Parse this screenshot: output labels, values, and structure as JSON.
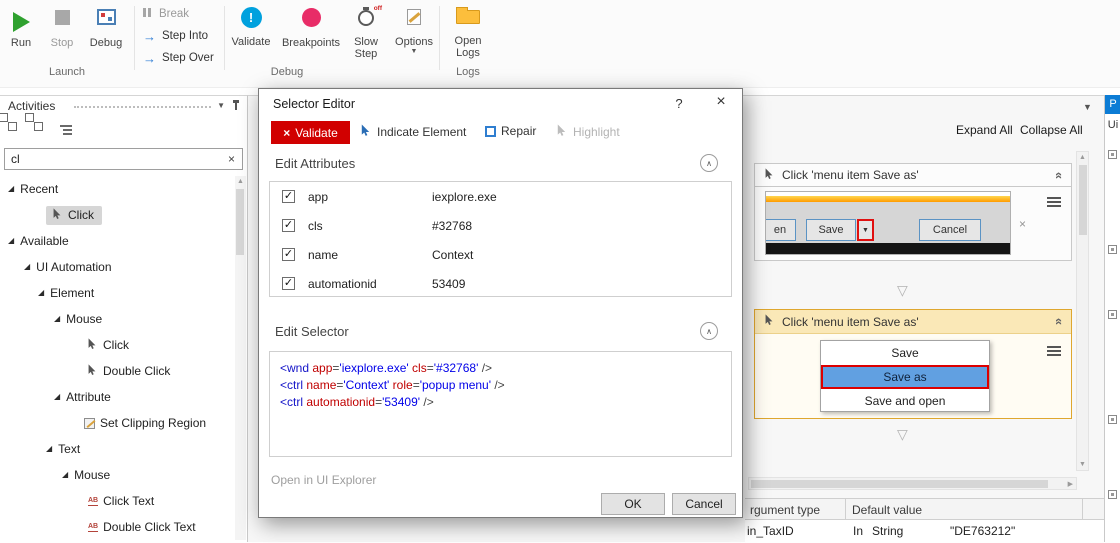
{
  "icons": {
    "dropdown": "▼",
    "expander_open": "◢",
    "close": "×",
    "help": "?",
    "search_clear": "×",
    "section_collapse": "∧",
    "card_collapse": "«",
    "connector_triangle": "▽",
    "scroll_up": "▲",
    "scroll_down": "▼",
    "scroll_right": "▶",
    "exclamation": "!",
    "validate_x": "×",
    "screenshot_close": "×",
    "save_dropdown": "▼",
    "text_icon": "AB",
    "menu_grip": "≡"
  },
  "ribbon": {
    "run_label": "Run",
    "stop_label": "Stop",
    "debug_label": "Debug",
    "break_label": "Break",
    "step_into_label": "Step Into",
    "step_over_label": "Step Over",
    "validate_label": "Validate",
    "breakpoints_label": "Breakpoints",
    "slow_step_label_1": "Slow",
    "slow_step_label_2": "Step",
    "slow_step_off": "off",
    "options_label": "Options",
    "open_logs_label_1": "Open",
    "open_logs_label_2": "Logs",
    "group_launch": "Launch",
    "group_debug": "Debug",
    "group_logs": "Logs"
  },
  "activities": {
    "title": "Activities",
    "search_value": "cl",
    "tree": [
      {
        "label": "Recent"
      },
      {
        "label": "Click",
        "selected": true
      },
      {
        "label": "Available"
      },
      {
        "label": "UI Automation"
      },
      {
        "label": "Element"
      },
      {
        "label": "Mouse"
      },
      {
        "label": "Click"
      },
      {
        "label": "Double Click"
      },
      {
        "label": "Attribute"
      },
      {
        "label": "Set Clipping Region"
      },
      {
        "label": "Text"
      },
      {
        "label": "Mouse"
      },
      {
        "label": "Click Text"
      },
      {
        "label": "Double Click Text"
      }
    ]
  },
  "dialog": {
    "title": "Selector Editor",
    "toolbar": {
      "validate": "Validate",
      "indicate_element": "Indicate Element",
      "repair": "Repair",
      "highlight": "Highlight"
    },
    "edit_attributes_title": "Edit Attributes",
    "attributes": [
      {
        "checked": true,
        "name": "app",
        "value": "iexplore.exe"
      },
      {
        "checked": true,
        "name": "cls",
        "value": "#32768"
      },
      {
        "checked": true,
        "name": "name",
        "value": "Context"
      },
      {
        "checked": true,
        "name": "automationid",
        "value": "53409"
      }
    ],
    "edit_selector_title": "Edit Selector",
    "selector_lines": [
      [
        [
          "tag",
          "<wnd "
        ],
        [
          "attr",
          "app"
        ],
        [
          "pun",
          "="
        ],
        [
          "val",
          "'iexplore.exe'"
        ],
        [
          "pun",
          " "
        ],
        [
          "attr",
          "cls"
        ],
        [
          "pun",
          "="
        ],
        [
          "val",
          "'#32768'"
        ],
        [
          "pun",
          " />"
        ]
      ],
      [
        [
          "tag",
          "<ctrl "
        ],
        [
          "attr",
          "name"
        ],
        [
          "pun",
          "="
        ],
        [
          "val",
          "'Context'"
        ],
        [
          "pun",
          " "
        ],
        [
          "attr",
          "role"
        ],
        [
          "pun",
          "="
        ],
        [
          "val",
          "'popup menu'"
        ],
        [
          "pun",
          " />"
        ]
      ],
      [
        [
          "tag",
          "<ctrl "
        ],
        [
          "attr",
          "automationid"
        ],
        [
          "pun",
          "="
        ],
        [
          "val",
          "'53409'"
        ],
        [
          "pun",
          " />"
        ]
      ]
    ],
    "open_in_ui_explorer": "Open in UI Explorer",
    "ok_label": "OK",
    "cancel_label": "Cancel"
  },
  "designer": {
    "expand_all": "Expand All",
    "collapse_all": "Collapse All",
    "activity_top": {
      "title": "Click 'menu item  Save as'",
      "screenshot": {
        "partial_button": "en",
        "save_button": "Save",
        "cancel_button": "Cancel"
      }
    },
    "activity_selected": {
      "title": "Click 'menu item  Save as'",
      "menu_items": [
        "Save",
        "Save as",
        "Save and open"
      ],
      "highlighted_item": "Save as"
    }
  },
  "arguments_panel": {
    "header_argument_type": "rgument type",
    "header_default_value": "Default value",
    "row": {
      "name": "in_TaxID",
      "direction": "In",
      "argument_type": "String",
      "default_value": "\"DE763212\""
    }
  },
  "right_strip": {
    "properties_tab": "P",
    "ui_label": "Ui"
  }
}
